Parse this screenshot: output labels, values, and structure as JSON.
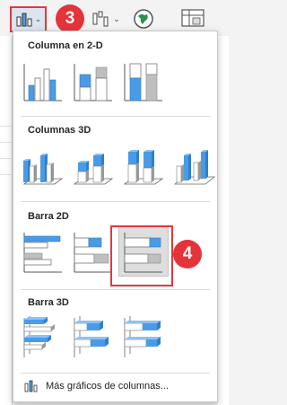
{
  "callouts": {
    "step_a": "3",
    "step_b": "4"
  },
  "ribbon": {
    "icons": [
      "column-chart-icon",
      "waterfall-chart-icon",
      "map-chart-icon",
      "pivot-chart-icon"
    ]
  },
  "menu": {
    "sections": [
      {
        "title": "Columna en 2-D",
        "items": [
          "clustered-column",
          "stacked-column",
          "100-stacked-column"
        ]
      },
      {
        "title": "Columnas 3D",
        "items": [
          "3d-clustered-column",
          "3d-stacked-column",
          "3d-100-stacked-column",
          "3d-column"
        ]
      },
      {
        "title": "Barra 2D",
        "items": [
          "clustered-bar",
          "stacked-bar",
          "100-stacked-bar"
        ],
        "selected": "100-stacked-bar"
      },
      {
        "title": "Barra 3D",
        "items": [
          "3d-clustered-bar",
          "3d-stacked-bar",
          "3d-100-stacked-bar"
        ]
      }
    ],
    "more_link": "Más gráficos de columnas..."
  },
  "colors": {
    "accent_blue": "#4a9be6",
    "bar_gray": "#bfbfbf",
    "callout_red": "#e5333a"
  }
}
